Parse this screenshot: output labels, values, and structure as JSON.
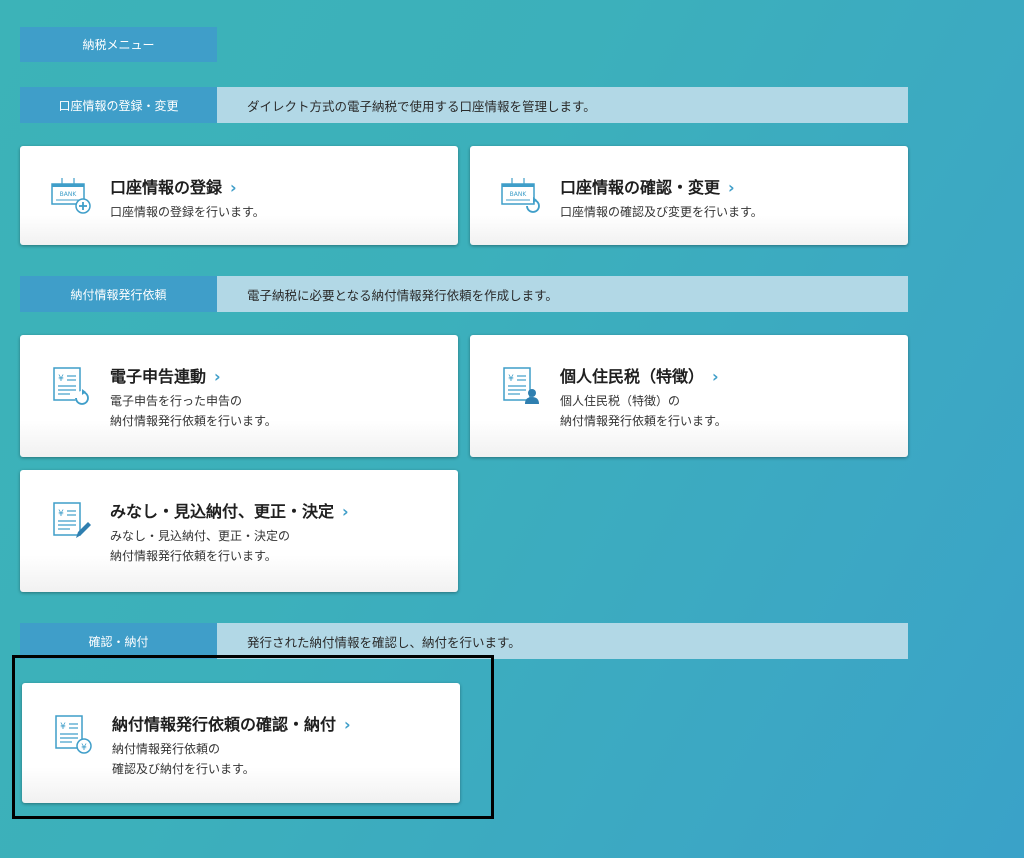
{
  "menu_tab": "納税メニュー",
  "sections": [
    {
      "label": "口座情報の登録・変更",
      "desc": "ダイレクト方式の電子納税で使用する口座情報を管理します。"
    },
    {
      "label": "納付情報発行依頼",
      "desc": "電子納税に必要となる納付情報発行依頼を作成します。"
    },
    {
      "label": "確認・納付",
      "desc": "発行された納付情報を確認し、納付を行います。"
    }
  ],
  "cards": [
    {
      "title": "口座情報の登録",
      "sub1": "口座情報の登録を行います。",
      "sub2": ""
    },
    {
      "title": "口座情報の確認・変更",
      "sub1": "口座情報の確認及び変更を行います。",
      "sub2": ""
    },
    {
      "title": "電子申告連動",
      "sub1": "電子申告を行った申告の",
      "sub2": "納付情報発行依頼を行います。"
    },
    {
      "title": "個人住民税（特徴）",
      "sub1": "個人住民税（特徴）の",
      "sub2": "納付情報発行依頼を行います。"
    },
    {
      "title": "みなし・見込納付、更正・決定",
      "sub1": "みなし・見込納付、更正・決定の",
      "sub2": "納付情報発行依頼を行います。"
    },
    {
      "title": "納付情報発行依頼の確認・納付",
      "sub1": "納付情報発行依頼の",
      "sub2": "確認及び納付を行います。"
    }
  ],
  "chevron": "›",
  "colors": {
    "accent": "#3f9ec9",
    "section_bg": "#b2d8e6",
    "highlight": "#000000"
  },
  "icons": [
    "bank-add-icon",
    "bank-refresh-icon",
    "document-refresh-icon",
    "document-person-icon",
    "document-pencil-icon",
    "document-payment-icon"
  ]
}
